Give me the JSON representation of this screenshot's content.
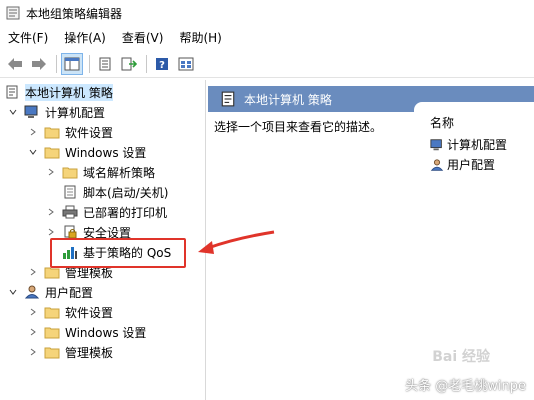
{
  "window": {
    "title": "本地组策略编辑器"
  },
  "menu": [
    {
      "label": "文件(F)"
    },
    {
      "label": "操作(A)"
    },
    {
      "label": "查看(V)"
    },
    {
      "label": "帮助(H)"
    }
  ],
  "toolbar": {
    "icons": [
      "back-arrow-icon",
      "forward-arrow-icon",
      "console-tree-icon",
      "properties-icon",
      "export-list-icon",
      "help-icon",
      "view-icon"
    ]
  },
  "tree": {
    "root": "本地计算机 策略",
    "computer_config": "计算机配置",
    "software_settings_1": "软件设置",
    "windows_settings_1": "Windows 设置",
    "dns_policy": "域名解析策略",
    "scripts": "脚本(启动/关机)",
    "printers": "已部署的打印机",
    "security": "安全设置",
    "qos": "基于策略的 QoS",
    "admin_templates_1": "管理模板",
    "user_config": "用户配置",
    "software_settings_2": "软件设置",
    "windows_settings_2": "Windows 设置",
    "admin_templates_2": "管理模板"
  },
  "right": {
    "header": "本地计算机 策略",
    "description": "选择一个项目来查看它的描述。",
    "column_name": "名称",
    "items": [
      {
        "label": "计算机配置"
      },
      {
        "label": "用户配置"
      }
    ]
  },
  "colors": {
    "header_bg": "#6a8cbe",
    "highlight_red": "#e0342a",
    "selection": "#cce8ff"
  },
  "watermark": {
    "text": "头条 @老毛桃winpe",
    "baidu": "Bai 经验"
  }
}
